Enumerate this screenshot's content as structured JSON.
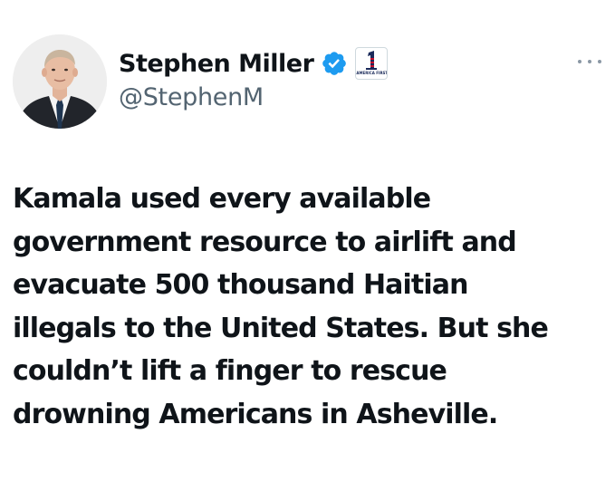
{
  "author": {
    "display_name": "Stephen Miller",
    "handle": "@StephenM",
    "verified": true,
    "affiliate_badge": {
      "label": "AMERICA FIRST",
      "icon": "america-first-number-one-icon"
    },
    "avatar_icon": "profile-photo"
  },
  "more_options_icon": "more-horizontal-icon",
  "tweet": {
    "lines": [
      "Kamala used every available",
      "government resource to airlift and",
      "evacuate 500 thousand Haitian",
      "illegals to the United States. But she",
      "couldn’t lift a finger to rescue",
      "drowning Americans in Asheville."
    ]
  },
  "colors": {
    "text_primary": "#0f1419",
    "text_secondary": "#536471",
    "verified_blue": "#1d9bf0",
    "background": "#ffffff"
  }
}
